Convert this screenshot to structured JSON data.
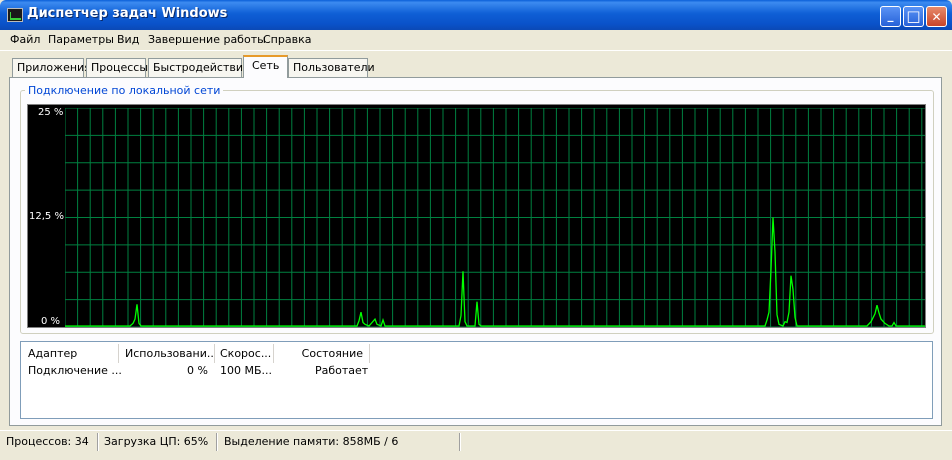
{
  "window": {
    "title": "Диспетчер задач Windows",
    "minimize": "_",
    "maximize": "□",
    "close": "✕"
  },
  "menu": [
    "Файл",
    "Параметры",
    "Вид",
    "Завершение работы",
    "Справка"
  ],
  "tabs": [
    "Приложения",
    "Процессы",
    "Быстродействие",
    "Сеть",
    "Пользователи"
  ],
  "active_tab": "Сеть",
  "graph": {
    "title": "Подключение по локальной сети",
    "y_ticks": [
      "25 %",
      "12,5 %",
      "0 %"
    ],
    "y_max_percent": 25,
    "grid_color": "#008040",
    "line_color": "#00ff00",
    "background": "#000000"
  },
  "chart_data": {
    "type": "line",
    "title": "Подключение по локальной сети",
    "ylim": [
      0,
      25
    ],
    "y_tick_labels": [
      "0 %",
      "12,5 %",
      "25 %"
    ],
    "series": [
      {
        "points": [
          [
            0,
            0
          ],
          [
            65,
            0
          ],
          [
            68,
            0.3
          ],
          [
            70,
            0.8
          ],
          [
            72,
            2.5
          ],
          [
            74,
            0.3
          ],
          [
            76,
            0
          ],
          [
            292,
            0
          ],
          [
            294,
            0.6
          ],
          [
            296,
            1.6
          ],
          [
            298,
            0.4
          ],
          [
            300,
            0.2
          ],
          [
            304,
            0
          ],
          [
            310,
            0.8
          ],
          [
            312,
            0.2
          ],
          [
            316,
            0
          ],
          [
            318,
            0.7
          ],
          [
            320,
            0
          ],
          [
            394,
            0
          ],
          [
            396,
            1.2
          ],
          [
            398,
            6.3
          ],
          [
            400,
            0.5
          ],
          [
            402,
            0
          ],
          [
            410,
            0
          ],
          [
            412,
            2.8
          ],
          [
            414,
            0.2
          ],
          [
            416,
            0
          ],
          [
            700,
            0
          ],
          [
            702,
            0.7
          ],
          [
            704,
            1.6
          ],
          [
            706,
            6.5
          ],
          [
            708,
            12.5
          ],
          [
            710,
            8.5
          ],
          [
            712,
            1.3
          ],
          [
            714,
            0.2
          ],
          [
            718,
            0
          ],
          [
            720,
            0.5
          ],
          [
            722,
            0.4
          ],
          [
            724,
            1.6
          ],
          [
            726,
            5.8
          ],
          [
            728,
            4.2
          ],
          [
            730,
            1.0
          ],
          [
            732,
            0
          ],
          [
            802,
            0
          ],
          [
            806,
            0.5
          ],
          [
            810,
            1.4
          ],
          [
            812,
            2.4
          ],
          [
            814,
            1.5
          ],
          [
            816,
            0.8
          ],
          [
            820,
            0.3
          ],
          [
            824,
            0
          ],
          [
            827,
            0
          ],
          [
            829,
            0.4
          ],
          [
            831,
            0
          ],
          [
            860,
            0
          ]
        ]
      }
    ],
    "x_range": [
      0,
      860
    ]
  },
  "list": {
    "columns": [
      "Адаптер",
      "Использовани...",
      "Скорос...",
      "Состояние"
    ],
    "rows": [
      [
        "Подключение ...",
        "0 %",
        "100 МБ...",
        "Работает"
      ]
    ]
  },
  "status": {
    "processes": "Процессов: 34",
    "cpu": "Загрузка ЦП: 65%",
    "memory": "Выделение памяти: 858МБ / 6"
  }
}
